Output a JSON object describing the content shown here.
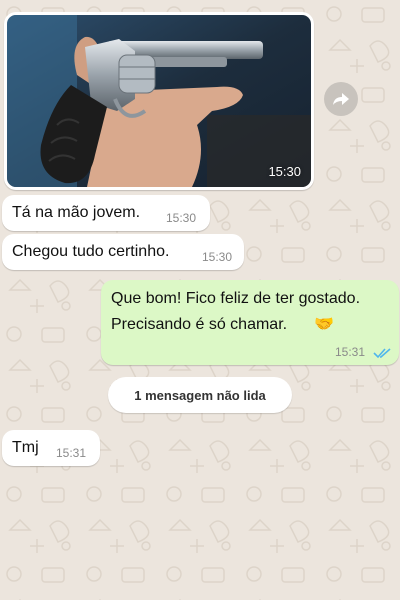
{
  "chat": {
    "photo_message": {
      "time": "15:30",
      "forward_icon": "forward-icon"
    },
    "messages": [
      {
        "direction": "incoming",
        "text": "Tá na mão jovem.",
        "time": "15:30"
      },
      {
        "direction": "incoming",
        "text": "Chegou tudo certinho.",
        "time": "15:30"
      },
      {
        "direction": "outgoing",
        "line1": "Que bom! Fico feliz de ter gostado.",
        "line2": "Precisando é só chamar.",
        "emoji": "🤝",
        "time": "15:31",
        "status_icon": "double-check-read-icon"
      },
      {
        "direction": "incoming",
        "text": "Tmj",
        "time": "15:31"
      }
    ],
    "unread_divider": "1 mensagem não lida"
  },
  "colors": {
    "wallpaper": "#ece5dd",
    "incoming_bubble": "#ffffff",
    "outgoing_bubble": "#dcf8c6",
    "read_ticks": "#4fb6ec"
  }
}
